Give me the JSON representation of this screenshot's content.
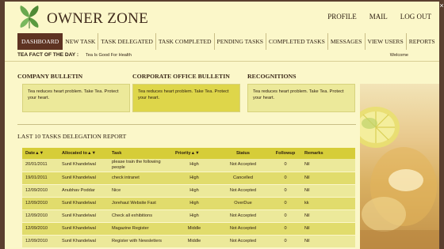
{
  "header": {
    "brand": "OWNER ZONE",
    "links": [
      "PROFILE",
      "MAIL",
      "LOG OUT"
    ],
    "close": "×"
  },
  "nav": {
    "items": [
      "DASHBOARD",
      "NEW TASK",
      "TASK DELEGATED",
      "TASK COMPLETED",
      "PENDING TASKS",
      "COMPLETED TASKS",
      "MESSAGES",
      "VIEW USERS",
      "REPORTS"
    ],
    "active": "DASHBOARD"
  },
  "fact": {
    "title": "TEA FACT OF THE DAY :",
    "text": "Tea Is Good For Health",
    "welcome": "Welcome"
  },
  "bulletins": [
    {
      "title": "COMPANY BULLETIN",
      "text": "Tea reduces heart problem. Take Tea. Protect your heart."
    },
    {
      "title": "CORPORATE OFFICE BULLETIN",
      "text": "Tea reduces heart problem. Take Tea. Protect your heart."
    },
    {
      "title": "RECOGNITIONS",
      "text": "Tea reduces heart problem. Take Tea. Protect your heart."
    }
  ],
  "report": {
    "title": "LAST 10 TASKS DELEGATION REPORT",
    "columns": [
      "Date▲▼",
      "Allocated to▲▼",
      "Task",
      "Priority▲▼",
      "Status",
      "Followup",
      "Remarks"
    ],
    "rows": [
      [
        "20/01/2011",
        "Sunil Khandelwal",
        "please train the following people",
        "High",
        "Not Accepted",
        "0",
        "Nil"
      ],
      [
        "19/01/2011",
        "Sunil Khandelwal",
        "check intranet",
        "High",
        "Cancelled",
        "0",
        "Nil"
      ],
      [
        "12/09/2010",
        "Anubhav Poddar",
        "Nice",
        "High",
        "Not Accepted",
        "0",
        "Nil"
      ],
      [
        "12/09/2010",
        "Sunil Khandelwal",
        "Jorehaut Website Fast",
        "High",
        "OverDue",
        "0",
        "kk"
      ],
      [
        "12/09/2010",
        "Sunil Khandelwal",
        "Check all exhibitions",
        "High",
        "Not Accepted",
        "0",
        "Nil"
      ],
      [
        "12/09/2010",
        "Sunil Khandelwal",
        "Magazine Register",
        "Middle",
        "Not Accepted",
        "0",
        "Nil"
      ],
      [
        "12/09/2010",
        "Sunil Khandelwal",
        "Register with Newsletters",
        "Middle",
        "Not Accepted",
        "0",
        "Nil"
      ]
    ]
  },
  "colors": {
    "page_bg": "#fbf7c9",
    "frame": "#5a3f2f",
    "nav_active": "#5e3322",
    "table_head": "#d6cd38",
    "row_light": "#ece99a",
    "row_dark": "#e1dc6c",
    "highlight_box": "#ded64a"
  },
  "icons": {
    "logo": "tea-leaf-logo-icon",
    "close": "close-icon"
  }
}
